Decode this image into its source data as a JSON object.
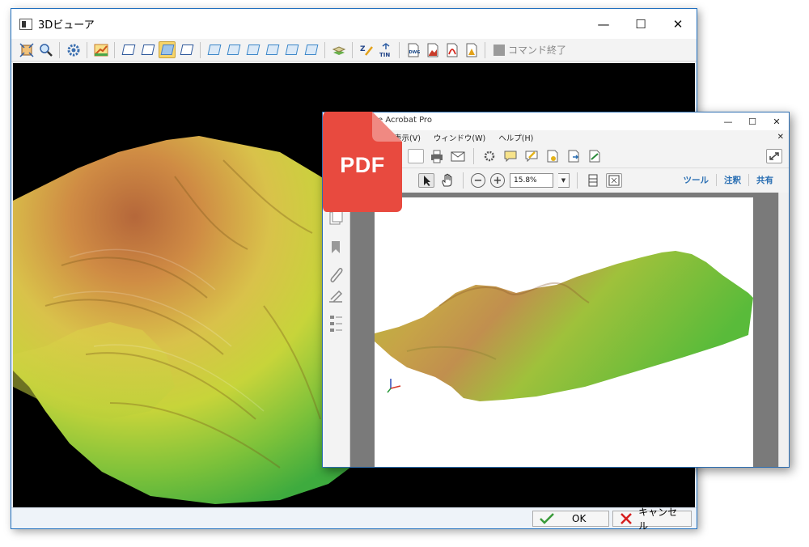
{
  "viewer": {
    "title": "3Dビューア",
    "controls": {
      "minimize": "—",
      "maximize": "☐",
      "close": "✕"
    },
    "command_end_label": "コマンド終了",
    "ok_label": "OK",
    "cancel_label": "キャンセル"
  },
  "acrobat": {
    "title": "e Acrobat Pro",
    "controls": {
      "minimize": "—",
      "maximize": "☐",
      "close": "✕"
    },
    "menu": [
      "表示(V)",
      "ウィンドウ(W)",
      "ヘルプ(H)"
    ],
    "zoom": "15.8%",
    "right_links": [
      "ツール",
      "注釈",
      "共有"
    ]
  },
  "badge": {
    "text": "PDF",
    "color": "#e84a3f"
  }
}
